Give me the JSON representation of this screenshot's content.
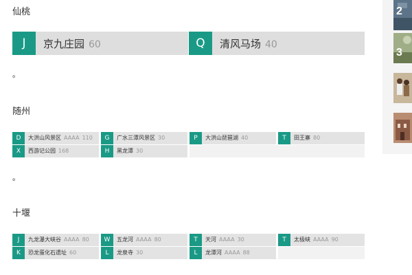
{
  "sections": [
    {
      "title": "仙桃",
      "big_items": [
        {
          "letter": "J",
          "name": "京九庄园",
          "count": "60"
        },
        {
          "letter": "Q",
          "name": "清风马场",
          "count": "40"
        }
      ],
      "dot": "。"
    },
    {
      "title": "随州",
      "items": [
        {
          "letter": "D",
          "name": "大洪山风景区",
          "level": "AAAA",
          "count": "110"
        },
        {
          "letter": "G",
          "name": "广水三潭风景区",
          "level": "",
          "count": "30"
        },
        {
          "letter": "P",
          "name": "大洪山琵琶湖",
          "level": "",
          "count": "40"
        },
        {
          "letter": "T",
          "name": "田王寨",
          "level": "",
          "count": "80"
        },
        {
          "letter": "X",
          "name": "西游记公园",
          "level": "",
          "count": "168"
        },
        {
          "letter": "H",
          "name": "黑龙潭",
          "level": "",
          "count": "30"
        }
      ],
      "dot": "。"
    },
    {
      "title": "十堰",
      "items": [
        {
          "letter": "J",
          "name": "九龙瀑大峡谷",
          "level": "AAAA",
          "count": "80"
        },
        {
          "letter": "W",
          "name": "五龙河",
          "level": "AAAA",
          "count": "80"
        },
        {
          "letter": "T",
          "name": "天河",
          "level": "AAAA",
          "count": "30"
        },
        {
          "letter": "T",
          "name": "太极峡",
          "level": "AAAA",
          "count": "90"
        },
        {
          "letter": "K",
          "name": "恐龙蛋化石遗址",
          "level": "",
          "count": "60"
        },
        {
          "letter": "L",
          "name": "龙泉寺",
          "level": "",
          "count": "30"
        },
        {
          "letter": "L",
          "name": "龙潭河",
          "level": "AAAA",
          "count": "88"
        }
      ]
    }
  ],
  "sidebar": {
    "thumbs": [
      {
        "num": "2",
        "color": "#5d7488"
      },
      {
        "num": "3",
        "color": "#8a9a6e"
      },
      {
        "num": "",
        "color": "#a88c6a"
      },
      {
        "num": "",
        "color": "#8b5a44"
      }
    ]
  },
  "colors": {
    "accent": "#1a9a86",
    "item_bg": "#e3e3e3",
    "empty_bg": "#f2f2f2"
  }
}
